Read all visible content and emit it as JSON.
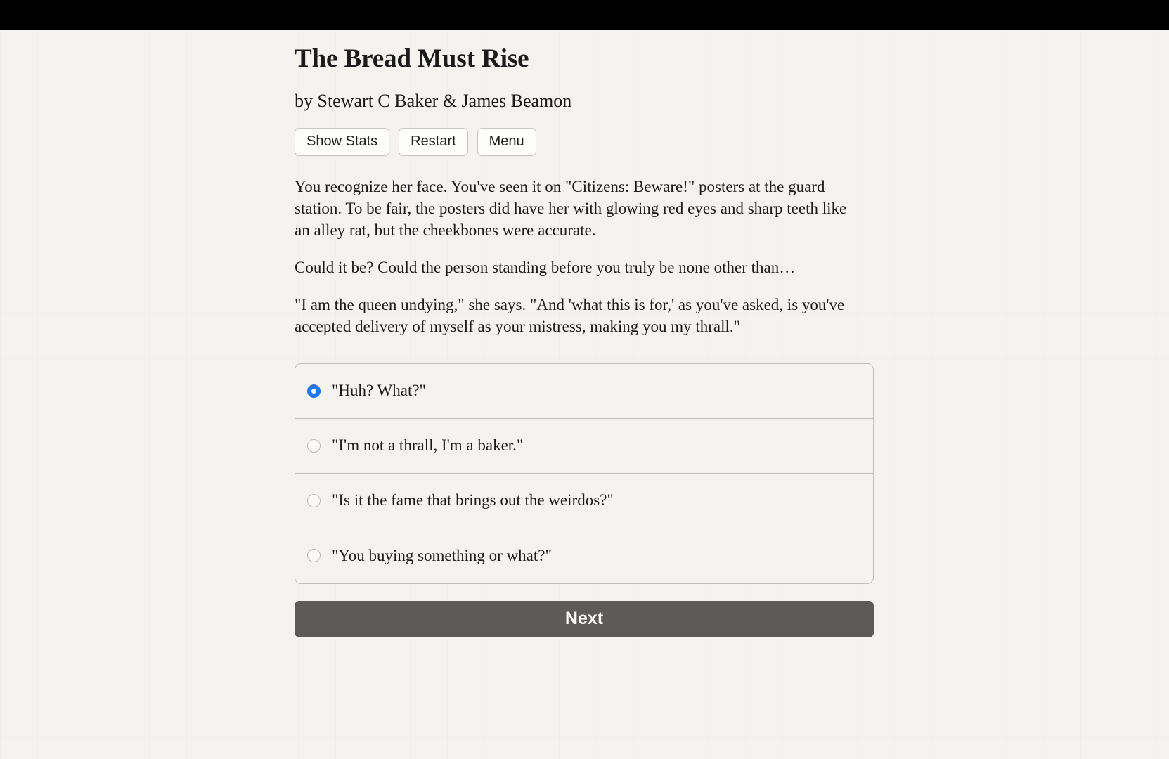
{
  "window": {
    "top_bar_color": "#000000",
    "page_background_color": "#f5f3ef"
  },
  "story": {
    "title": "The Bread Must Rise",
    "byline": "by Stewart C Baker & James Beamon"
  },
  "toolbar": {
    "show_stats_label": "Show Stats",
    "restart_label": "Restart",
    "menu_label": "Menu"
  },
  "prose": {
    "paragraphs": [
      "You recognize her face. You've seen it on \"Citizens: Beware!\" posters at the guard station. To be fair, the posters did have her with glowing red eyes and sharp teeth like an alley rat, but the cheekbones were accurate.",
      "Could it be? Could the person standing before you truly be none other than…",
      "\"I am the queen undying,\" she says. \"And 'what this is for,' as you've asked, is you've accepted delivery of myself as your mistress, making you my thrall.\""
    ]
  },
  "choices": {
    "selected_index": 0,
    "selected_color": "#2176ef",
    "options": [
      {
        "label": "\"Huh? What?\"",
        "selected": true
      },
      {
        "label": "\"I'm not a thrall, I'm a baker.\"",
        "selected": false
      },
      {
        "label": "\"Is it the fame that brings out the weirdos?\"",
        "selected": false
      },
      {
        "label": "\"You buying something or what?\"",
        "selected": false
      }
    ]
  },
  "next": {
    "label": "Next",
    "background_color": "#5d5b57"
  }
}
